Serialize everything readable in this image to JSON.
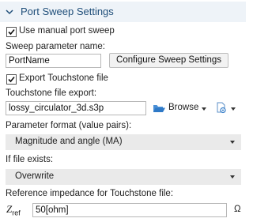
{
  "section": {
    "title": "Port Sweep Settings"
  },
  "use_manual_sweep": {
    "label": "Use manual port sweep",
    "checked": true
  },
  "sweep_param": {
    "label": "Sweep parameter name:",
    "value": "PortName",
    "configure_button": "Configure Sweep Settings"
  },
  "export_touchstone": {
    "label": "Export Touchstone file",
    "checked": true
  },
  "touchstone_file": {
    "label": "Touchstone file export:",
    "value": "lossy_circulator_3d.s3p",
    "browse_label": "Browse"
  },
  "parameter_format": {
    "label": "Parameter format (value pairs):",
    "selected": "Magnitude and angle (MA)"
  },
  "if_file_exists": {
    "label": "If file exists:",
    "selected": "Overwrite"
  },
  "reference_impedance": {
    "label": "Reference impedance for Touchstone file:",
    "symbol": "Z",
    "subscript": "ref",
    "value": "50[ohm]",
    "unit": "Ω"
  },
  "colors": {
    "header_bg": "#eef3f8",
    "title": "#1f4e79",
    "folder_icon": "#2e79c7",
    "select_bg": "#eaeaea"
  }
}
